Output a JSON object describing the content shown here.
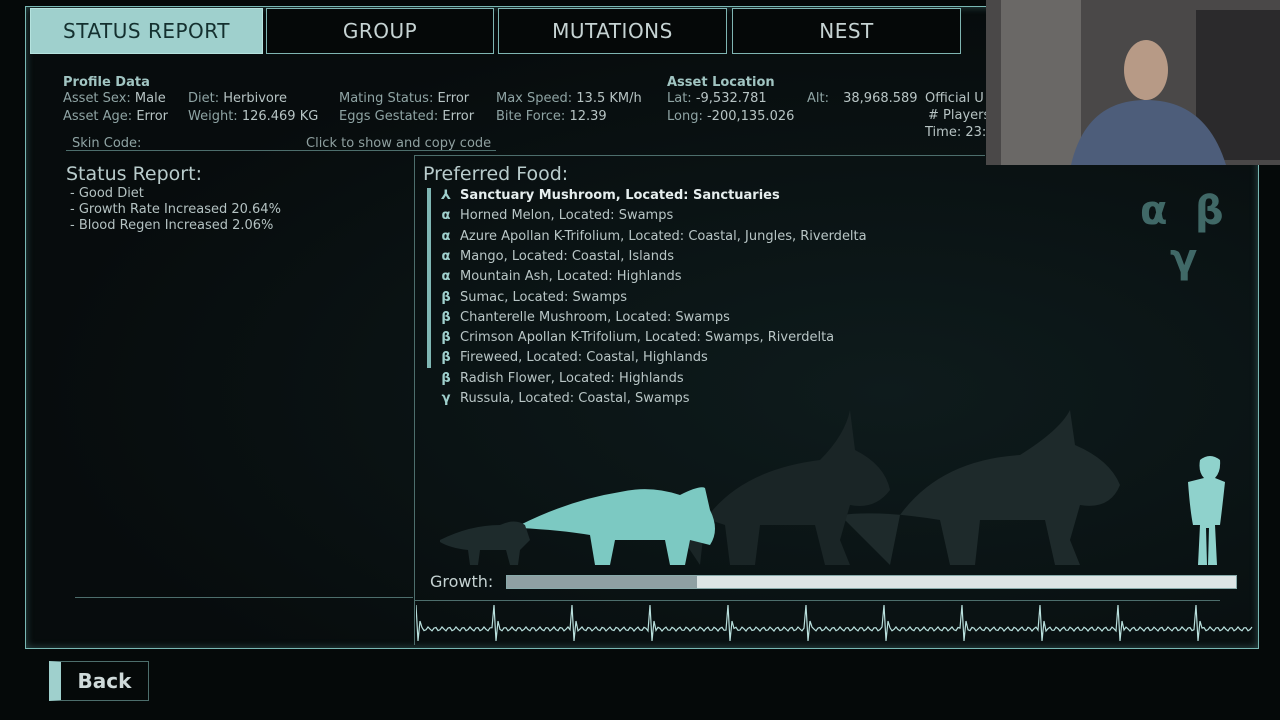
{
  "tabs": [
    {
      "label": "STATUS REPORT",
      "active": true
    },
    {
      "label": "GROUP",
      "active": false
    },
    {
      "label": "MUTATIONS",
      "active": false
    },
    {
      "label": "NEST",
      "active": false
    }
  ],
  "profile": {
    "heading": "Profile Data",
    "sex_label": "Asset Sex:",
    "sex": "Male",
    "age_label": "Asset Age:",
    "age": "Error",
    "diet_label": "Diet:",
    "diet": "Herbivore",
    "weight_label": "Weight:",
    "weight": "126.469  KG",
    "mating_label": "Mating Status:",
    "mating": "Error",
    "eggs_label": "Eggs Gestated:",
    "eggs": "Error",
    "speed_label": "Max Speed:",
    "speed": "13.5  KM/h",
    "bite_label": "Bite Force:",
    "bite": "12.39",
    "skin_label": "Skin Code:",
    "skin_hint": "Click to show and copy code"
  },
  "location": {
    "heading": "Asset Location",
    "lat_label": "Lat:",
    "lat": "-9,532.781",
    "long_label": "Long:",
    "long": "-200,135.026",
    "alt_label": "Alt:",
    "alt": "38,968.589",
    "official": "Official U",
    "players": "# Players",
    "time": "Time: 23:"
  },
  "status_report": {
    "title": "Status  Report:",
    "items": [
      "- Good Diet",
      "- Growth Rate Increased 20.64%",
      "- Blood Regen Increased 2.06%"
    ]
  },
  "preferred_food": {
    "title": "Preferred Food:",
    "items": [
      {
        "glyph": "⅄",
        "text": "Sanctuary Mushroom, Located: Sanctuaries",
        "highlight": true
      },
      {
        "glyph": "α",
        "text": "Horned Melon, Located: Swamps"
      },
      {
        "glyph": "α",
        "text": "Azure Apollan K-Trifolium, Located: Coastal, Jungles, Riverdelta"
      },
      {
        "glyph": "α",
        "text": "Mango, Located: Coastal, Islands"
      },
      {
        "glyph": "α",
        "text": "Mountain Ash, Located: Highlands"
      },
      {
        "glyph": "β",
        "text": "Sumac, Located: Swamps"
      },
      {
        "glyph": "β",
        "text": "Chanterelle Mushroom, Located: Swamps"
      },
      {
        "glyph": "β",
        "text": "Crimson Apollan K-Trifolium, Located: Swamps, Riverdelta"
      },
      {
        "glyph": "β",
        "text": "Fireweed, Located: Coastal, Highlands"
      },
      {
        "glyph": "β",
        "text": "Radish Flower, Located: Highlands"
      },
      {
        "glyph": "γ",
        "text": "Russula, Located: Coastal, Swamps"
      }
    ]
  },
  "greek_badge": {
    "alpha": "α",
    "beta": "β",
    "gamma": "γ"
  },
  "growth": {
    "label": "Growth:",
    "fraction": 0.26
  },
  "back_button": {
    "label": "Back"
  },
  "colors": {
    "accent": "#9fd0cd",
    "border": "#79b8b4",
    "background": "#050909"
  }
}
